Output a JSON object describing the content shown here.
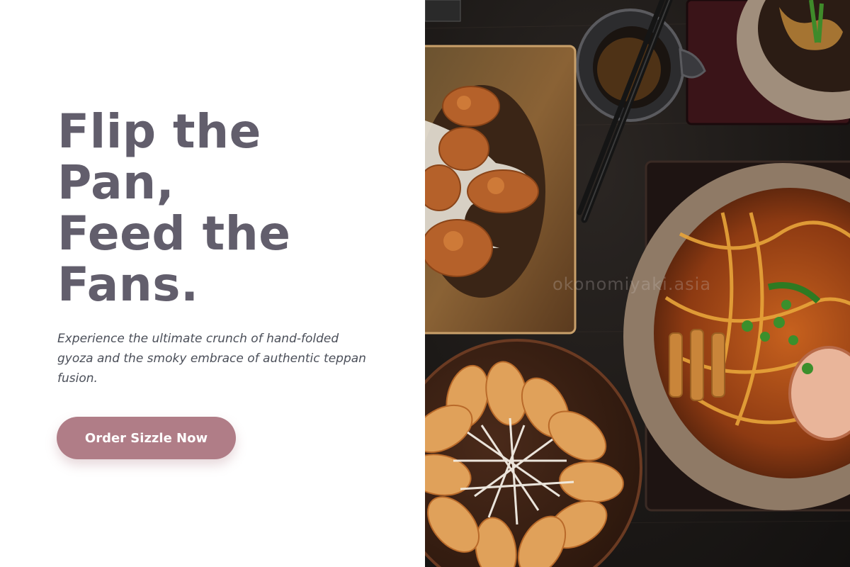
{
  "hero": {
    "title_lines": [
      "Flip the",
      "Pan,",
      "Feed the",
      "Fans."
    ],
    "subtitle": "Experience the ultimate crunch of hand-folded gyoza and the smoky embrace of authentic teppan fusion.",
    "cta_label": "Order Sizzle Now"
  },
  "photo": {
    "watermark": "okonomiyaki.asia",
    "dishes": [
      "karaage",
      "ramen",
      "gyoza",
      "dipping-sauce",
      "side-bowl",
      "chopsticks"
    ]
  },
  "colors": {
    "title": "#625e6c",
    "subtitle": "#4b4f59",
    "cta_background": "#b07d87",
    "cta_text": "#ffffff",
    "table": "#1b1816"
  }
}
